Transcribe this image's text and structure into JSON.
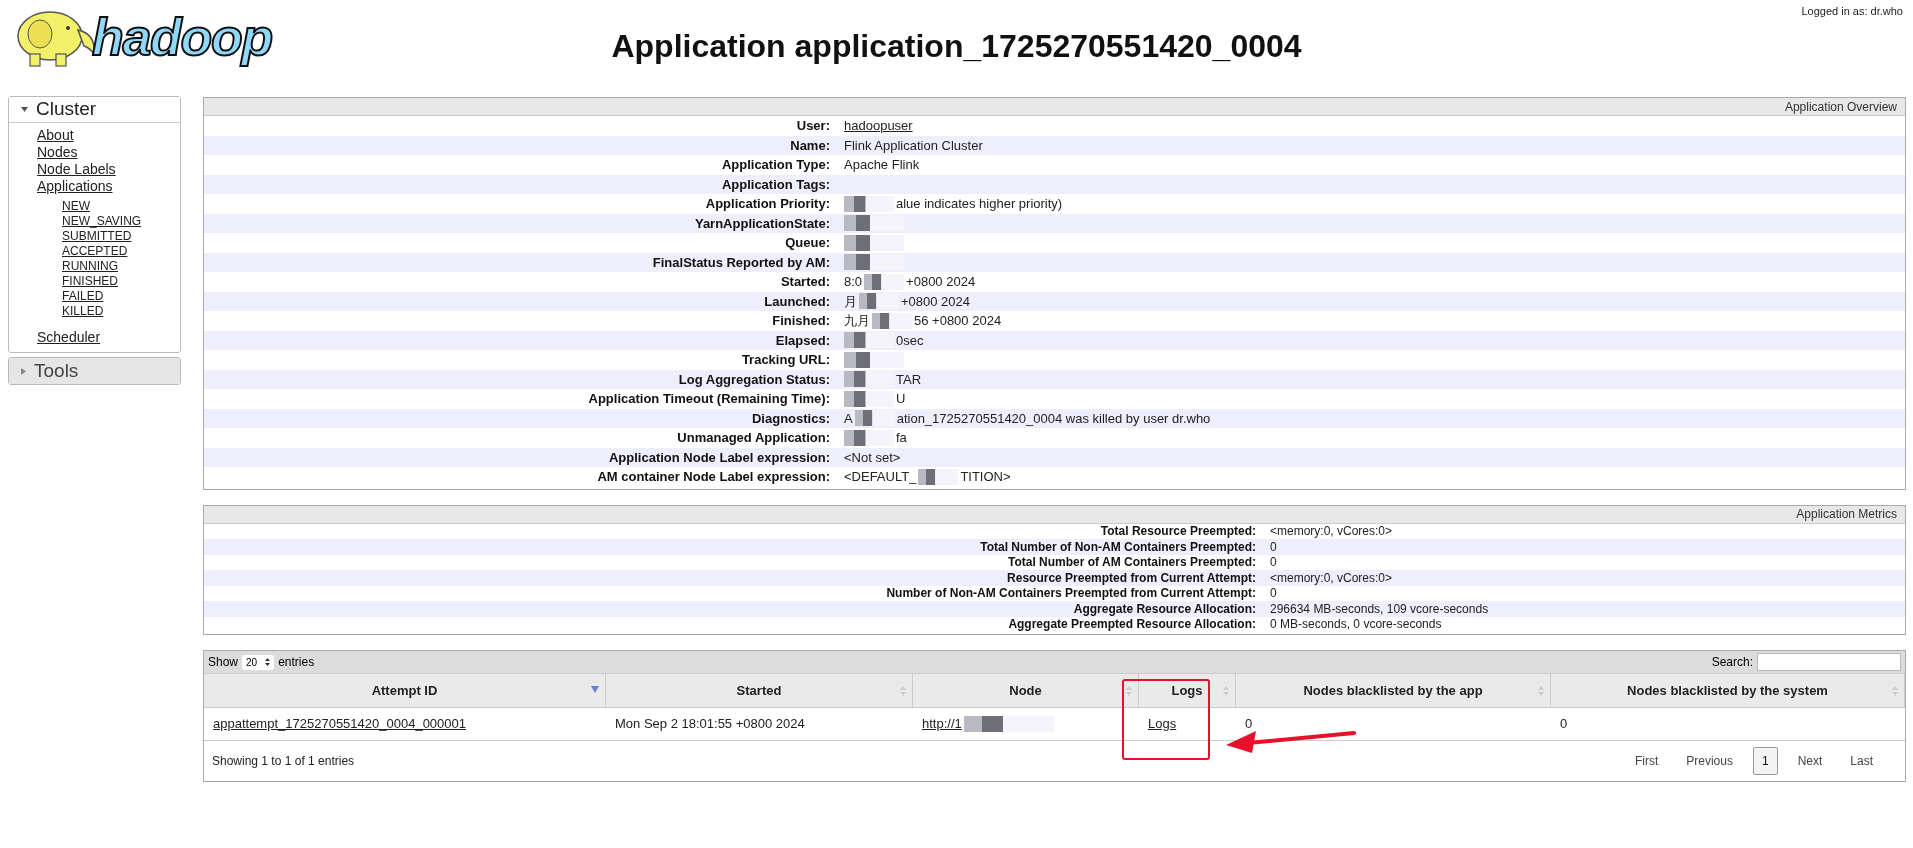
{
  "header": {
    "logo_text": "hadoop",
    "title": "Application application_1725270551420_0004",
    "logged_in": "Logged in as: dr.who"
  },
  "sidebar": [
    {
      "label": "Cluster",
      "expanded": true,
      "items": [
        {
          "label": "About"
        },
        {
          "label": "Nodes"
        },
        {
          "label": "Node Labels"
        },
        {
          "label": "Applications",
          "children": [
            {
              "label": "NEW"
            },
            {
              "label": "NEW_SAVING"
            },
            {
              "label": "SUBMITTED"
            },
            {
              "label": "ACCEPTED"
            },
            {
              "label": "RUNNING"
            },
            {
              "label": "FINISHED"
            },
            {
              "label": "FAILED"
            },
            {
              "label": "KILLED"
            }
          ]
        },
        {
          "label": "Scheduler"
        }
      ]
    },
    {
      "label": "Tools",
      "expanded": false
    }
  ],
  "overview": {
    "title": "Application Overview",
    "rows": [
      {
        "label": "User:",
        "parts": [
          "hadoopuser"
        ],
        "link": true,
        "redacted": false
      },
      {
        "label": "Name:",
        "parts": [
          "Flink Application Cluster"
        ],
        "link": false,
        "redacted": false
      },
      {
        "label": "Application Type:",
        "parts": [
          "Apache Flink"
        ],
        "link": false,
        "redacted": false
      },
      {
        "label": "Application Tags:",
        "parts": [],
        "redacted": false
      },
      {
        "label": "Application Priority:",
        "parts": [
          "alue indicates higher priority)"
        ],
        "link": false,
        "redacted": true
      },
      {
        "label": "YarnApplicationState:",
        "parts": [],
        "redacted": true
      },
      {
        "label": "Queue:",
        "parts": [],
        "redacted": true
      },
      {
        "label": "FinalStatus Reported by AM:",
        "parts": [],
        "redacted": true
      },
      {
        "label": "Started:",
        "parts": [
          "8:0",
          "+0800 2024"
        ],
        "link": false,
        "redacted": true
      },
      {
        "label": "Launched:",
        "parts": [
          "月",
          "+0800 2024"
        ],
        "link": false,
        "redacted": true
      },
      {
        "label": "Finished:",
        "parts": [
          "九月",
          "56 +0800 2024"
        ],
        "link": false,
        "redacted": true
      },
      {
        "label": "Elapsed:",
        "parts": [
          "0sec"
        ],
        "link": false,
        "redacted": true
      },
      {
        "label": "Tracking URL:",
        "parts": [],
        "redacted": true
      },
      {
        "label": "Log Aggregation Status:",
        "parts": [
          "TAR"
        ],
        "link": false,
        "redacted": true
      },
      {
        "label": "Application Timeout (Remaining Time):",
        "parts": [
          "U"
        ],
        "link": false,
        "redacted": true
      },
      {
        "label": "Diagnostics:",
        "parts": [
          "A",
          "ation_1725270551420_0004 was killed by user dr.who"
        ],
        "link": false,
        "redacted": true
      },
      {
        "label": "Unmanaged Application:",
        "parts": [
          "fa"
        ],
        "link": false,
        "redacted": true
      },
      {
        "label": "Application Node Label expression:",
        "parts": [
          "<Not set>"
        ],
        "link": false,
        "redacted": false
      },
      {
        "label": "AM container Node Label expression:",
        "parts": [
          "<DEFAULT_",
          "TITION>"
        ],
        "link": false,
        "redacted": true
      }
    ]
  },
  "metrics": {
    "title": "Application Metrics",
    "rows": [
      {
        "label": "Total Resource Preempted:",
        "value": "<memory:0, vCores:0>"
      },
      {
        "label": "Total Number of Non-AM Containers Preempted:",
        "value": "0"
      },
      {
        "label": "Total Number of AM Containers Preempted:",
        "value": "0"
      },
      {
        "label": "Resource Preempted from Current Attempt:",
        "value": "<memory:0, vCores:0>"
      },
      {
        "label": "Number of Non-AM Containers Preempted from Current Attempt:",
        "value": "0"
      },
      {
        "label": "Aggregate Resource Allocation:",
        "value": "296634 MB-seconds, 109 vcore-seconds"
      },
      {
        "label": "Aggregate Preempted Resource Allocation:",
        "value": "0 MB-seconds, 0 vcore-seconds"
      }
    ]
  },
  "attempts": {
    "show_label": "Show",
    "page_size": "20",
    "entries_label": "entries",
    "search_label": "Search:",
    "columns": [
      {
        "label": "Attempt ID",
        "sorted": true
      },
      {
        "label": "Started",
        "sorted": false
      },
      {
        "label": "Node",
        "sorted": false
      },
      {
        "label": "Logs",
        "sorted": false
      },
      {
        "label": "Nodes blacklisted by the app",
        "sorted": false
      },
      {
        "label": "Nodes blacklisted by the system",
        "sorted": false
      }
    ],
    "rows": [
      {
        "cells": [
          {
            "text": "appattempt_1725270551420_0004_000001",
            "link": true,
            "redacted": false
          },
          {
            "text": "Mon Sep 2 18:01:55 +0800 2024",
            "link": false,
            "redacted": false
          },
          {
            "text": "http://1",
            "link": true,
            "redacted": true
          },
          {
            "text": "Logs",
            "link": true,
            "redacted": false
          },
          {
            "text": "0",
            "link": false,
            "redacted": false
          },
          {
            "text": "0",
            "link": false,
            "redacted": false
          }
        ]
      }
    ],
    "info": "Showing 1 to 1 of 1 entries",
    "pages": [
      {
        "label": "First",
        "selected": false
      },
      {
        "label": "Previous",
        "selected": false
      },
      {
        "label": "1",
        "selected": true
      },
      {
        "label": "Next",
        "selected": false
      },
      {
        "label": "Last",
        "selected": false
      }
    ]
  }
}
